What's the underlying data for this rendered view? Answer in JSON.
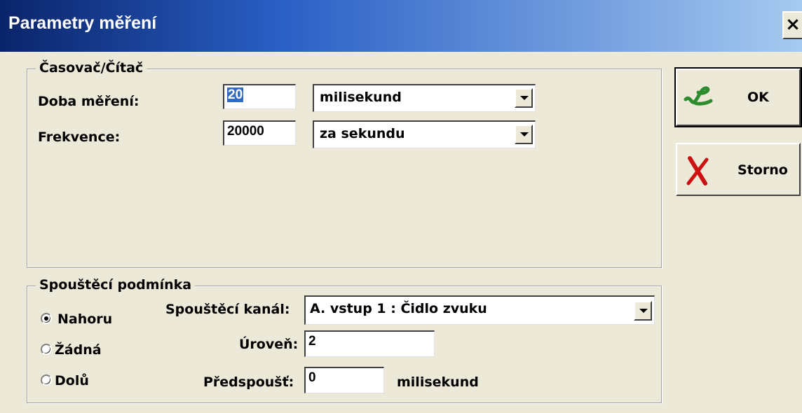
{
  "window": {
    "title": "Parametry měření",
    "close_glyph": "×"
  },
  "timer_group": {
    "legend": "Časovač/Čítač",
    "duration_label": "Doba měření:",
    "duration_value": "20",
    "duration_unit": "milisekund",
    "frequency_label": "Frekvence:",
    "frequency_value": "20000",
    "frequency_unit": "za sekundu"
  },
  "trigger_group": {
    "legend": "Spouštěcí podmínka",
    "radios": [
      {
        "label": "Nahoru",
        "checked": true
      },
      {
        "label": "Žádná",
        "checked": false
      },
      {
        "label": "Dolů",
        "checked": false
      }
    ],
    "channel_label": "Spouštěcí kanál:",
    "channel_value": "A. vstup 1 : Čidlo zvuku",
    "level_label": "Úroveň:",
    "level_value": "2",
    "pretrigger_label": "Předspoušť:",
    "pretrigger_value": "0",
    "pretrigger_unit": "milisekund"
  },
  "buttons": {
    "ok_label": "OK",
    "ok_icon": "green-check-icon",
    "cancel_label": "Storno",
    "cancel_icon": "red-x-icon"
  },
  "colors": {
    "title_gradient_start": "#0a246a",
    "title_gradient_end": "#a6caf0",
    "dialog_bg": "#ece9d8",
    "ok_icon": "#2e8b2e",
    "cancel_icon": "#cc1111"
  }
}
